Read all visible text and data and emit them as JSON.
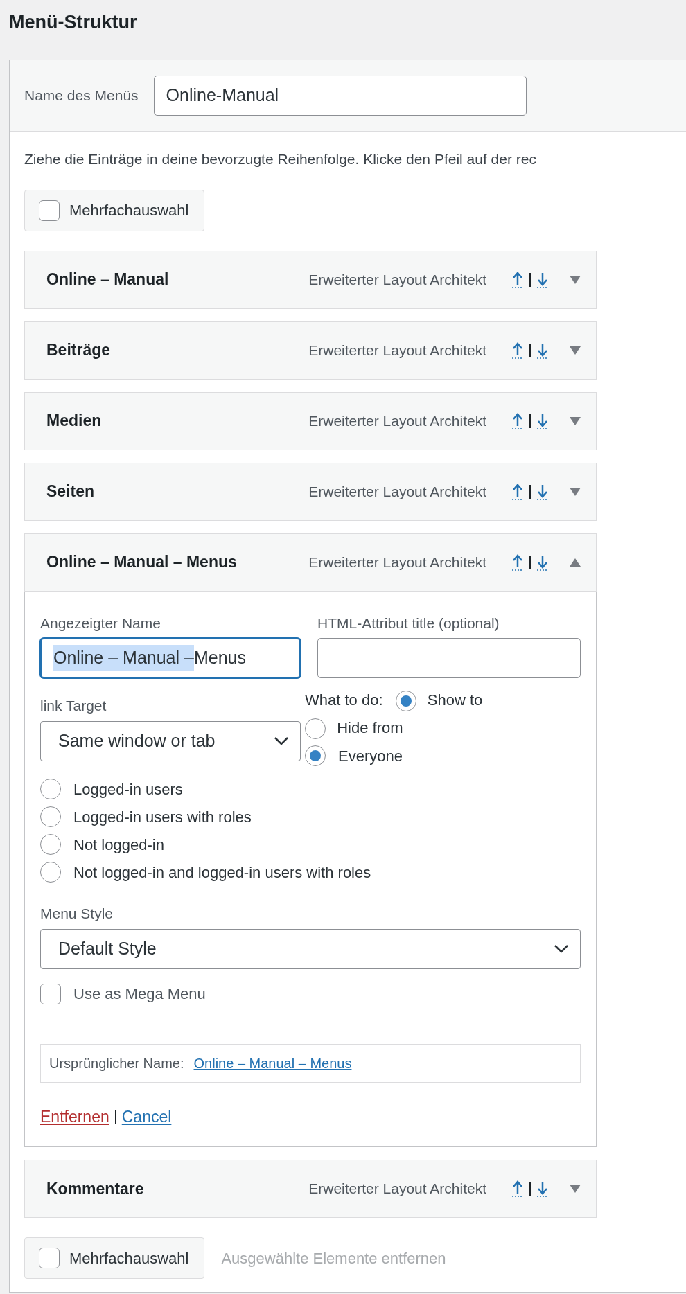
{
  "page_title": "Menü-Struktur",
  "menu_name": {
    "label": "Name des Menüs",
    "value": "Online-Manual"
  },
  "instructions": "Ziehe die Einträge in deine bevorzugte Reihenfolge. Klicke den Pfeil auf der rec",
  "bulk_select_top": {
    "label": "Mehrfachauswahl",
    "checked": false
  },
  "menu_items": [
    {
      "title": "Online – Manual",
      "type": "Erweiterter Layout Architekt",
      "expanded": false
    },
    {
      "title": "Beiträge",
      "type": "Erweiterter Layout Architekt",
      "expanded": false
    },
    {
      "title": "Medien",
      "type": "Erweiterter Layout Architekt",
      "expanded": false
    },
    {
      "title": "Seiten",
      "type": "Erweiterter Layout Architekt",
      "expanded": false
    },
    {
      "title": "Online – Manual – Menus",
      "type": "Erweiterter Layout Architekt",
      "expanded": true,
      "settings": {
        "navigation_label": {
          "label": "Angezeigter Name",
          "value_selected": "Online – Manual – ",
          "value_rest": "Menus"
        },
        "title_attribute": {
          "label": "HTML-Attribut title (optional)"
        },
        "link_target": {
          "label": "link Target",
          "value": "Same window or tab"
        },
        "visibility": {
          "label": "What to do:",
          "options": [
            {
              "label": "Show to",
              "selected": true
            },
            {
              "label": "Hide from",
              "selected": false
            }
          ]
        },
        "audience": [
          {
            "label": "Everyone",
            "selected": true
          },
          {
            "label": "Logged-in users",
            "selected": false
          },
          {
            "label": "Logged-in users with roles",
            "selected": false
          },
          {
            "label": "Not logged-in",
            "selected": false
          },
          {
            "label": "Not logged-in and logged-in users with roles",
            "selected": false
          }
        ],
        "menu_style": {
          "label": "Menu Style",
          "value": "Default Style"
        },
        "mega_menu": {
          "label": "Use as Mega Menu",
          "checked": false
        },
        "original": {
          "label": "Ursprünglicher Name:",
          "link": "Online – Manual – Menus"
        },
        "actions": [
          {
            "label": "Entfernen",
            "kind": "danger"
          },
          {
            "label": "Cancel",
            "kind": "link"
          }
        ]
      }
    },
    {
      "title": "Kommentare",
      "type": "Erweiterter Layout Architekt",
      "expanded": false
    }
  ],
  "bulk_select_bottom": {
    "label": "Mehrfachauswahl",
    "checked": false,
    "action": "Ausgewählte Elemente entfernen"
  }
}
